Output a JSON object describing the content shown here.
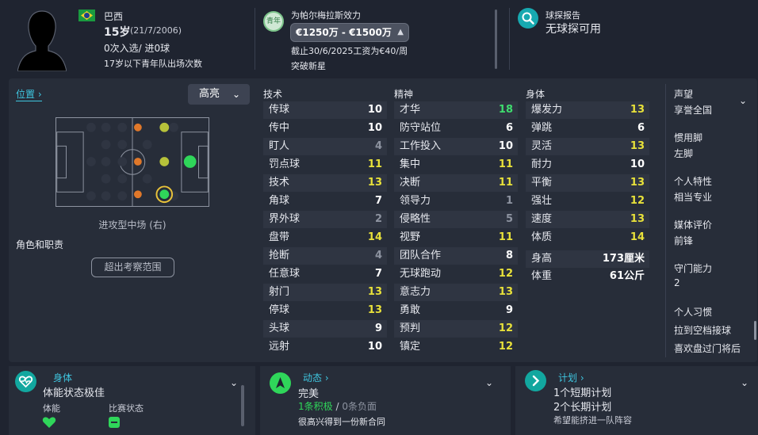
{
  "header": {
    "nationality": "巴西",
    "age": "15岁",
    "dob": "(21/7/2006)",
    "caps": "0次入选/ 进0球",
    "youth_caps": "17岁以下青年队出场次数",
    "youth_badge": "青年",
    "club_line": "为帕尔梅拉斯效力",
    "value_range": "€1250万 - €1500万",
    "contract": "截止30/6/2025工资为€40/周",
    "status": "突破新星",
    "scout_label": "球探报告",
    "scout_value": "无球探可用"
  },
  "position": {
    "link_label": "位置",
    "highlight_label": "高亮",
    "position_name": "进攻型中场 (右)",
    "roles_label": "角色和职责",
    "outside_button": "超出考察范围"
  },
  "attributes": {
    "technical_title": "技术",
    "mental_title": "精神",
    "physical_title": "身体",
    "technical": [
      {
        "name": "传球",
        "value": "10"
      },
      {
        "name": "传中",
        "value": "10"
      },
      {
        "name": "盯人",
        "value": "4"
      },
      {
        "name": "罚点球",
        "value": "11"
      },
      {
        "name": "技术",
        "value": "13"
      },
      {
        "name": "角球",
        "value": "7"
      },
      {
        "name": "界外球",
        "value": "2"
      },
      {
        "name": "盘带",
        "value": "14"
      },
      {
        "name": "抢断",
        "value": "4"
      },
      {
        "name": "任意球",
        "value": "7"
      },
      {
        "name": "射门",
        "value": "13"
      },
      {
        "name": "停球",
        "value": "13"
      },
      {
        "name": "头球",
        "value": "9"
      },
      {
        "name": "远射",
        "value": "10"
      }
    ],
    "mental": [
      {
        "name": "才华",
        "value": "18"
      },
      {
        "name": "防守站位",
        "value": "6"
      },
      {
        "name": "工作投入",
        "value": "10"
      },
      {
        "name": "集中",
        "value": "11"
      },
      {
        "name": "决断",
        "value": "11"
      },
      {
        "name": "领导力",
        "value": "1"
      },
      {
        "name": "侵略性",
        "value": "5"
      },
      {
        "name": "视野",
        "value": "11"
      },
      {
        "name": "团队合作",
        "value": "8"
      },
      {
        "name": "无球跑动",
        "value": "12"
      },
      {
        "name": "意志力",
        "value": "13"
      },
      {
        "name": "勇敢",
        "value": "9"
      },
      {
        "name": "预判",
        "value": "12"
      },
      {
        "name": "镇定",
        "value": "12"
      }
    ],
    "physical": [
      {
        "name": "爆发力",
        "value": "13"
      },
      {
        "name": "弹跳",
        "value": "6"
      },
      {
        "name": "灵活",
        "value": "13"
      },
      {
        "name": "耐力",
        "value": "10"
      },
      {
        "name": "平衡",
        "value": "13"
      },
      {
        "name": "强壮",
        "value": "12"
      },
      {
        "name": "速度",
        "value": "13"
      },
      {
        "name": "体质",
        "value": "14"
      }
    ],
    "height_label": "身高",
    "height_value": "173厘米",
    "weight_label": "体重",
    "weight_value": "61公斤"
  },
  "sidebar": {
    "reputation_label": "声望",
    "reputation_value": "享誉全国",
    "foot_label": "惯用脚",
    "foot_value": "左脚",
    "trait_label": "个人特性",
    "trait_value": "相当专业",
    "media_label": "媒体评价",
    "media_value": "前锋",
    "gk_label": "守门能力",
    "gk_value": "2",
    "habits_label": "个人习惯",
    "habit_1": "拉到空档接球",
    "habit_2": "喜欢盘过门将后"
  },
  "bottom": {
    "body_title": "身体",
    "body_status": "体能状态极佳",
    "fitness_label": "体能",
    "match_label": "比赛状态",
    "dynamic_title": "动态",
    "dynamic_value": "完美",
    "positive": "1条积极",
    "separator": "/",
    "negative": "0条负面",
    "dynamic_note": "很高兴得到一份新合同",
    "plan_title": "计划",
    "plan_short": "1个短期计划",
    "plan_long": "2个长期计划",
    "plan_note": "希望能挤进一队阵容"
  },
  "colors": {
    "accent": "#3fc6e0",
    "val_high": "#3fdc6e",
    "val_good": "#e8e13a",
    "val_mid": "#ffffff",
    "val_low": "#8d93a0",
    "role_orange": "#e0782a",
    "role_yellow": "#b7c23a",
    "role_green": "#2fd65a"
  },
  "icons": {
    "header": [
      "player-silhouette-icon",
      "brazil-flag-icon",
      "youth-badge-icon",
      "scout-search-icon"
    ],
    "bottom": [
      "heart-icon",
      "arrow-up-icon",
      "chevron-right-circle-icon"
    ]
  }
}
